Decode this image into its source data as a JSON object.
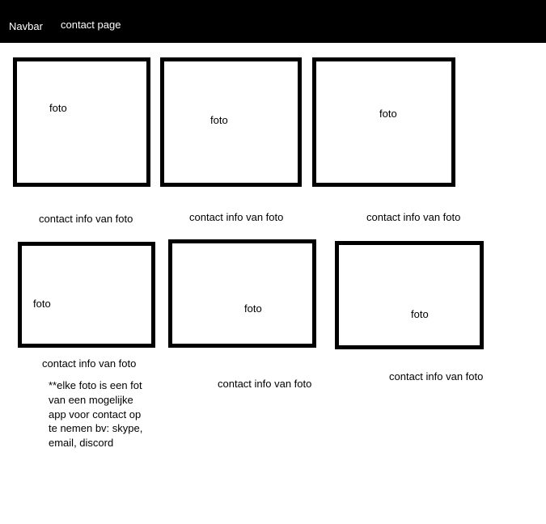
{
  "navbar": {
    "label": "Navbar",
    "page_title": "contact page"
  },
  "cards": [
    {
      "photo_label": "foto",
      "info": "contact info van foto"
    },
    {
      "photo_label": "foto",
      "info": "contact info van foto"
    },
    {
      "photo_label": "foto",
      "info": "contact info van foto"
    },
    {
      "photo_label": "foto",
      "info": "contact info van foto"
    },
    {
      "photo_label": "foto",
      "info": "contact info van foto"
    },
    {
      "photo_label": "foto",
      "info": "contact info van foto"
    }
  ],
  "note": "**elke foto is een fot van een mogelijke app voor contact op te nemen bv: skype, email, discord",
  "colors": {
    "navbar_background": "#000000",
    "navbar_text": "#ffffff",
    "box_border": "#000000",
    "page_background": "#ffffff"
  }
}
